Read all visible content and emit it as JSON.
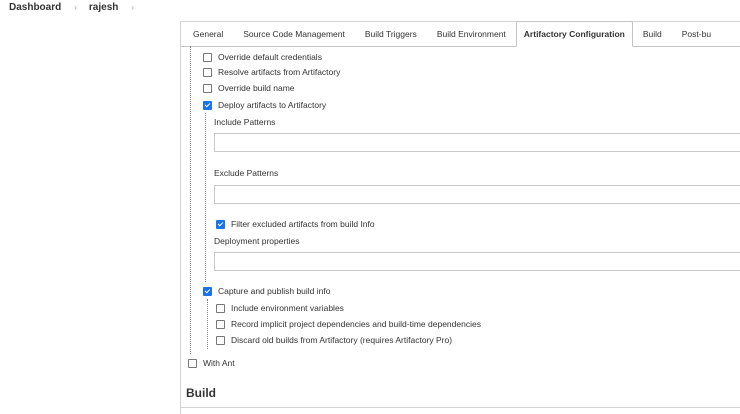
{
  "breadcrumb": {
    "items": [
      "Dashboard",
      "rajesh"
    ],
    "separator": "›"
  },
  "tabs": [
    "General",
    "Source Code Management",
    "Build Triggers",
    "Build Environment",
    "Artifactory Configuration",
    "Build",
    "Post-bu"
  ],
  "active_tab": "Artifactory Configuration",
  "options": {
    "override_credentials": {
      "label": "Override default credentials",
      "checked": false
    },
    "resolve_artifacts": {
      "label": "Resolve artifacts from Artifactory",
      "checked": false
    },
    "override_build_name": {
      "label": "Override build name",
      "checked": false
    },
    "deploy_artifacts": {
      "label": "Deploy artifacts to Artifactory",
      "checked": true
    },
    "filter_excluded": {
      "label": "Filter excluded artifacts from build Info",
      "checked": true
    },
    "capture_build_info": {
      "label": "Capture and publish build info",
      "checked": true
    },
    "include_env_vars": {
      "label": "Include environment variables",
      "checked": false
    },
    "record_dependencies": {
      "label": "Record implicit project dependencies and build-time dependencies",
      "checked": false
    },
    "discard_old_builds": {
      "label": "Discard old builds from Artifactory (requires Artifactory Pro)",
      "checked": false
    },
    "with_ant": {
      "label": "With Ant",
      "checked": false
    }
  },
  "fields": {
    "include_patterns": {
      "label": "Include Patterns",
      "value": ""
    },
    "exclude_patterns": {
      "label": "Exclude Patterns",
      "value": ""
    },
    "deployment_properties": {
      "label": "Deployment properties",
      "value": ""
    }
  },
  "section_title": "Build",
  "colors": {
    "checkbox_checked": "#1a73e8",
    "border": "#c9c9c9",
    "text": "#333333"
  }
}
